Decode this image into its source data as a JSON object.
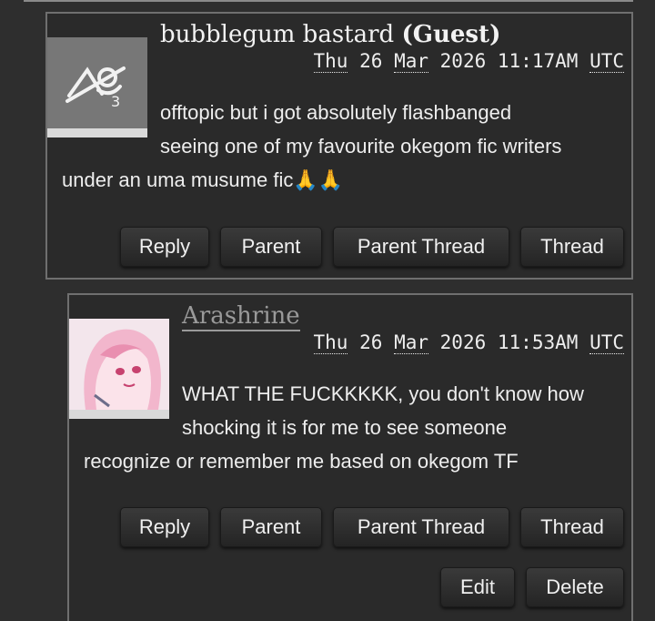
{
  "comments": [
    {
      "author": "bubblegum bastard",
      "author_tag": "(Guest)",
      "date": {
        "weekday": "Thu",
        "day": "26",
        "month": "Mar",
        "year": "2026",
        "time": "11:17AM",
        "tz": "UTC"
      },
      "body_line1": "offtopic but i got absolutely flashbanged",
      "body_line2": "seeing one of my favourite okegom fic writers",
      "body_line3": "under an uma musume fic🙏🙏",
      "buttons": {
        "reply": "Reply",
        "parent": "Parent",
        "parent_thread": "Parent Thread",
        "thread": "Thread"
      }
    },
    {
      "author": "Arashrine",
      "date": {
        "weekday": "Thu",
        "day": "26",
        "month": "Mar",
        "year": "2026",
        "time": "11:53AM",
        "tz": "UTC"
      },
      "body_line1": "WHAT THE FUCKKKKK, you don't know how",
      "body_line2": "shocking it is for me to see someone",
      "body_line3": "recognize or remember me based on okegom TF",
      "buttons": {
        "reply": "Reply",
        "parent": "Parent",
        "parent_thread": "Parent Thread",
        "thread": "Thread",
        "edit": "Edit",
        "delete": "Delete"
      }
    }
  ],
  "colors": {
    "background": "#2e2e2e",
    "panel": "#2a2a2a",
    "border": "#6f6f6f",
    "author_link": "#9a9a9a"
  }
}
